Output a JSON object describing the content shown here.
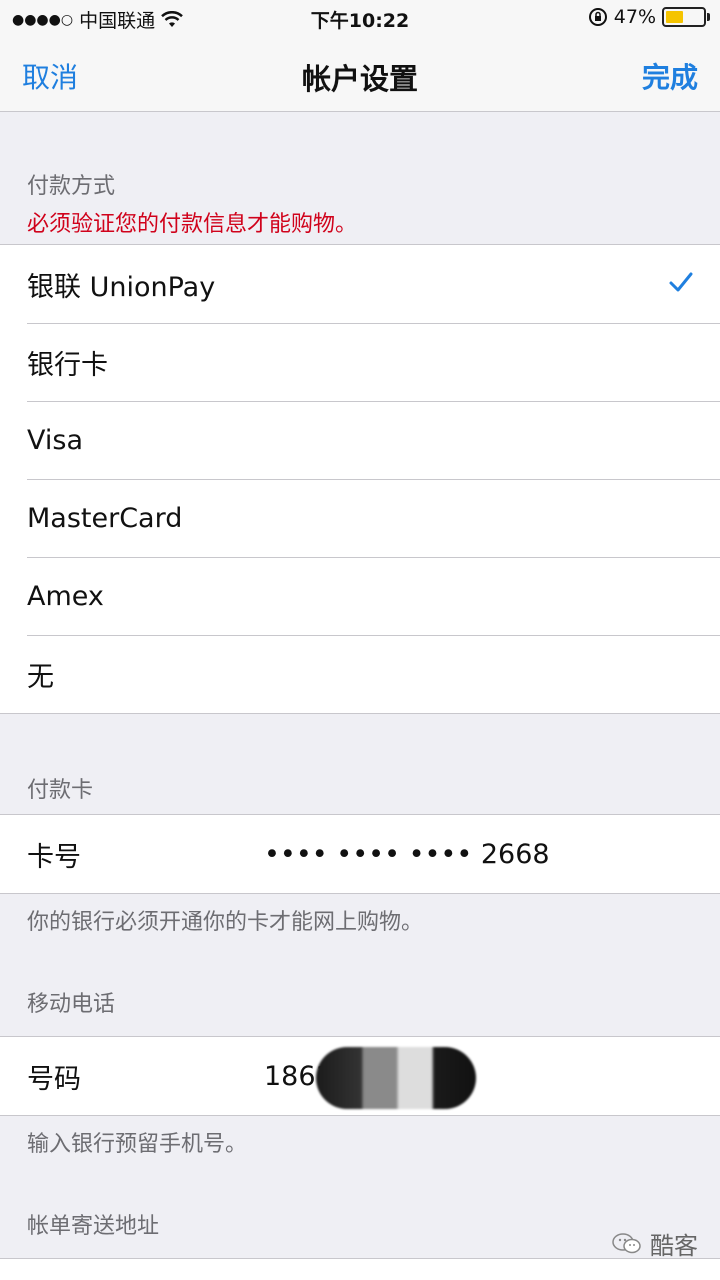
{
  "status": {
    "carrier": "中国联通",
    "time": "下午10:22",
    "battery_text": "47%",
    "battery_level": 0.47,
    "signal_dots": "●●●●○"
  },
  "nav": {
    "cancel": "取消",
    "title": "帐户设置",
    "done": "完成"
  },
  "payment": {
    "header": "付款方式",
    "warning": "必须验证您的付款信息才能购物。",
    "options": [
      "银联 UnionPay",
      "银行卡",
      "Visa",
      "MasterCard",
      "Amex",
      "无"
    ],
    "selected_index": 0
  },
  "card": {
    "header": "付款卡",
    "label": "卡号",
    "value": "•••• •••• •••• 2668",
    "note": "你的银行必须开通你的卡才能网上购物。"
  },
  "phone": {
    "header": "移动电话",
    "label": "号码",
    "value": "1861",
    "note": "输入银行预留手机号。"
  },
  "billing": {
    "header": "帐单寄送地址"
  },
  "watermark": {
    "text": "酷客"
  },
  "colors": {
    "accent": "#1f7fdf",
    "warning": "#d0021b",
    "battery": "#f5c400"
  }
}
